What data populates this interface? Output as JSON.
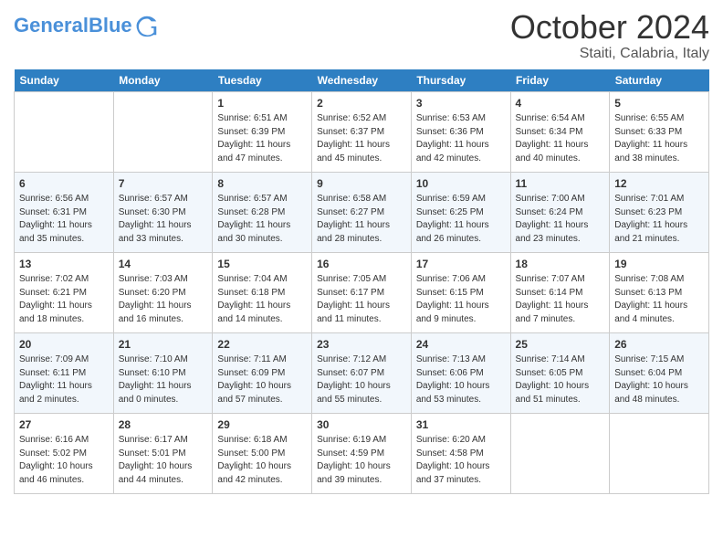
{
  "header": {
    "logo_general": "General",
    "logo_blue": "Blue",
    "month": "October 2024",
    "location": "Staiti, Calabria, Italy"
  },
  "weekdays": [
    "Sunday",
    "Monday",
    "Tuesday",
    "Wednesday",
    "Thursday",
    "Friday",
    "Saturday"
  ],
  "weeks": [
    [
      {
        "day": "",
        "info": ""
      },
      {
        "day": "",
        "info": ""
      },
      {
        "day": "1",
        "info": "Sunrise: 6:51 AM\nSunset: 6:39 PM\nDaylight: 11 hours and 47 minutes."
      },
      {
        "day": "2",
        "info": "Sunrise: 6:52 AM\nSunset: 6:37 PM\nDaylight: 11 hours and 45 minutes."
      },
      {
        "day": "3",
        "info": "Sunrise: 6:53 AM\nSunset: 6:36 PM\nDaylight: 11 hours and 42 minutes."
      },
      {
        "day": "4",
        "info": "Sunrise: 6:54 AM\nSunset: 6:34 PM\nDaylight: 11 hours and 40 minutes."
      },
      {
        "day": "5",
        "info": "Sunrise: 6:55 AM\nSunset: 6:33 PM\nDaylight: 11 hours and 38 minutes."
      }
    ],
    [
      {
        "day": "6",
        "info": "Sunrise: 6:56 AM\nSunset: 6:31 PM\nDaylight: 11 hours and 35 minutes."
      },
      {
        "day": "7",
        "info": "Sunrise: 6:57 AM\nSunset: 6:30 PM\nDaylight: 11 hours and 33 minutes."
      },
      {
        "day": "8",
        "info": "Sunrise: 6:57 AM\nSunset: 6:28 PM\nDaylight: 11 hours and 30 minutes."
      },
      {
        "day": "9",
        "info": "Sunrise: 6:58 AM\nSunset: 6:27 PM\nDaylight: 11 hours and 28 minutes."
      },
      {
        "day": "10",
        "info": "Sunrise: 6:59 AM\nSunset: 6:25 PM\nDaylight: 11 hours and 26 minutes."
      },
      {
        "day": "11",
        "info": "Sunrise: 7:00 AM\nSunset: 6:24 PM\nDaylight: 11 hours and 23 minutes."
      },
      {
        "day": "12",
        "info": "Sunrise: 7:01 AM\nSunset: 6:23 PM\nDaylight: 11 hours and 21 minutes."
      }
    ],
    [
      {
        "day": "13",
        "info": "Sunrise: 7:02 AM\nSunset: 6:21 PM\nDaylight: 11 hours and 18 minutes."
      },
      {
        "day": "14",
        "info": "Sunrise: 7:03 AM\nSunset: 6:20 PM\nDaylight: 11 hours and 16 minutes."
      },
      {
        "day": "15",
        "info": "Sunrise: 7:04 AM\nSunset: 6:18 PM\nDaylight: 11 hours and 14 minutes."
      },
      {
        "day": "16",
        "info": "Sunrise: 7:05 AM\nSunset: 6:17 PM\nDaylight: 11 hours and 11 minutes."
      },
      {
        "day": "17",
        "info": "Sunrise: 7:06 AM\nSunset: 6:15 PM\nDaylight: 11 hours and 9 minutes."
      },
      {
        "day": "18",
        "info": "Sunrise: 7:07 AM\nSunset: 6:14 PM\nDaylight: 11 hours and 7 minutes."
      },
      {
        "day": "19",
        "info": "Sunrise: 7:08 AM\nSunset: 6:13 PM\nDaylight: 11 hours and 4 minutes."
      }
    ],
    [
      {
        "day": "20",
        "info": "Sunrise: 7:09 AM\nSunset: 6:11 PM\nDaylight: 11 hours and 2 minutes."
      },
      {
        "day": "21",
        "info": "Sunrise: 7:10 AM\nSunset: 6:10 PM\nDaylight: 11 hours and 0 minutes."
      },
      {
        "day": "22",
        "info": "Sunrise: 7:11 AM\nSunset: 6:09 PM\nDaylight: 10 hours and 57 minutes."
      },
      {
        "day": "23",
        "info": "Sunrise: 7:12 AM\nSunset: 6:07 PM\nDaylight: 10 hours and 55 minutes."
      },
      {
        "day": "24",
        "info": "Sunrise: 7:13 AM\nSunset: 6:06 PM\nDaylight: 10 hours and 53 minutes."
      },
      {
        "day": "25",
        "info": "Sunrise: 7:14 AM\nSunset: 6:05 PM\nDaylight: 10 hours and 51 minutes."
      },
      {
        "day": "26",
        "info": "Sunrise: 7:15 AM\nSunset: 6:04 PM\nDaylight: 10 hours and 48 minutes."
      }
    ],
    [
      {
        "day": "27",
        "info": "Sunrise: 6:16 AM\nSunset: 5:02 PM\nDaylight: 10 hours and 46 minutes."
      },
      {
        "day": "28",
        "info": "Sunrise: 6:17 AM\nSunset: 5:01 PM\nDaylight: 10 hours and 44 minutes."
      },
      {
        "day": "29",
        "info": "Sunrise: 6:18 AM\nSunset: 5:00 PM\nDaylight: 10 hours and 42 minutes."
      },
      {
        "day": "30",
        "info": "Sunrise: 6:19 AM\nSunset: 4:59 PM\nDaylight: 10 hours and 39 minutes."
      },
      {
        "day": "31",
        "info": "Sunrise: 6:20 AM\nSunset: 4:58 PM\nDaylight: 10 hours and 37 minutes."
      },
      {
        "day": "",
        "info": ""
      },
      {
        "day": "",
        "info": ""
      }
    ]
  ]
}
